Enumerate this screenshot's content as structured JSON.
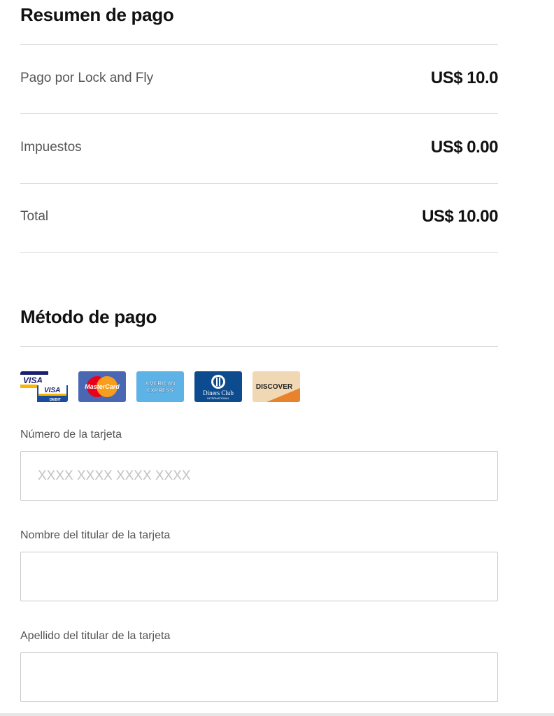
{
  "summary": {
    "title": "Resumen de pago",
    "rows": [
      {
        "label": "Pago por Lock and Fly",
        "value": "US$ 10.0"
      },
      {
        "label": "Impuestos",
        "value": "US$ 0.00"
      },
      {
        "label": "Total",
        "value": "US$ 10.00"
      }
    ]
  },
  "payment": {
    "title": "Método de pago",
    "card_brands": [
      {
        "icon": "visa-debit-icon",
        "text": "VISA",
        "subtext": "DEBIT"
      },
      {
        "icon": "mastercard-icon",
        "text": "MasterCard"
      },
      {
        "icon": "american-express-icon",
        "text": "AMERICAN",
        "subtext": "EXPRESS"
      },
      {
        "icon": "diners-club-icon",
        "text": "Diners Club",
        "subtext": "INTERNATIONAL"
      },
      {
        "icon": "discover-icon",
        "text": "DISCOVER"
      }
    ],
    "fields": {
      "card_number": {
        "label": "Número de la tarjeta",
        "placeholder": "XXXX XXXX XXXX XXXX",
        "value": ""
      },
      "first_name": {
        "label": "Nombre del titular de la tarjeta",
        "placeholder": "",
        "value": ""
      },
      "last_name": {
        "label": "Apellido del titular de la tarjeta",
        "placeholder": "",
        "value": ""
      }
    }
  },
  "colors": {
    "divider": "#dcdcdc",
    "input_border": "#c9c9c9",
    "placeholder": "#c2c2c2"
  }
}
